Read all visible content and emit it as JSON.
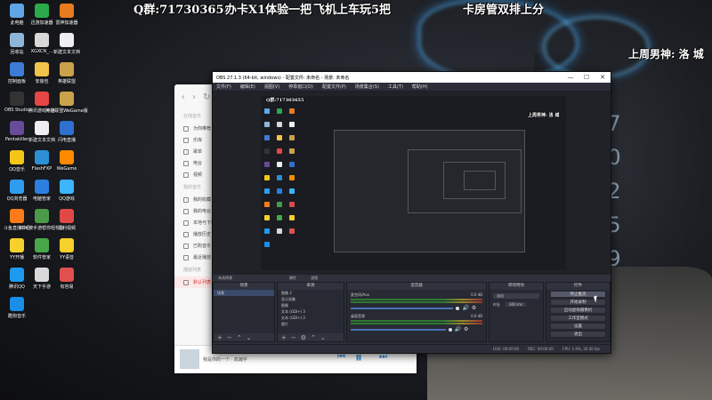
{
  "overlay": {
    "qq_group": "Q群:717303655",
    "card_promo": "办卡X1体验一把",
    "plane_promo": "飞机上车玩5把",
    "room_promo": "卡房管双排上分",
    "weekly_top": "上周男神: 洛 城"
  },
  "desktop_icons": [
    {
      "label": "此电脑",
      "color": "#5ea6e6"
    },
    {
      "label": "迅游加速器",
      "color": "#2aa84a"
    },
    {
      "label": "雷神加速器",
      "color": "#e87b1e"
    },
    {
      "label": "回收站",
      "color": "#8fb5d8"
    },
    {
      "label": "XGXCN_...",
      "color": "#d9d9d9"
    },
    {
      "label": "新建文本文档",
      "color": "#eeeeee"
    },
    {
      "label": "控制面板",
      "color": "#3d7bd6"
    },
    {
      "label": "安装包",
      "color": "#f0c34a"
    },
    {
      "label": "英雄联盟",
      "color": "#c9a24a"
    },
    {
      "label": "OBS Studio",
      "color": "#333333"
    },
    {
      "label": "腾讯游戏平台",
      "color": "#e64545"
    },
    {
      "label": "英雄联盟WeGame版",
      "color": "#c9a24a"
    },
    {
      "label": "Pentakiller",
      "color": "#6a4a9a"
    },
    {
      "label": "新建文本文档",
      "color": "#eeeeee"
    },
    {
      "label": "闪电直播",
      "color": "#2f6fd0"
    },
    {
      "label": "QQ音乐",
      "color": "#f5c518"
    },
    {
      "label": "FlashFXP",
      "color": "#2d8fd5"
    },
    {
      "label": "WeGame",
      "color": "#ff8a00"
    },
    {
      "label": "QQ浏览器",
      "color": "#2f9cf0"
    },
    {
      "label": "电脑管家",
      "color": "#2b7fe0"
    },
    {
      "label": "QQ游戏",
      "color": "#3cb4ff"
    },
    {
      "label": "斗鱼直播伴侣",
      "color": "#ff7a1a"
    },
    {
      "label": "KOK被手游帮你轻松玩",
      "color": "#4a9a4a"
    },
    {
      "label": "福利视频",
      "color": "#e04848"
    },
    {
      "label": "YY开播",
      "color": "#f6d02b"
    },
    {
      "label": "软件管家",
      "color": "#48a848"
    },
    {
      "label": "YY语音",
      "color": "#f6d02b"
    },
    {
      "label": "腾讯QQ",
      "color": "#1e9bf0"
    },
    {
      "label": "天下手游",
      "color": "#d9d9d9"
    },
    {
      "label": "有容易",
      "color": "#e05050"
    },
    {
      "label": "酷狗音乐",
      "color": "#1a8fe8"
    }
  ],
  "player": {
    "sections": [
      "在线音乐",
      "我的音乐",
      "播放列表"
    ],
    "online_items": [
      "为你推荐",
      "乐库",
      "歌单",
      "电台",
      "视频"
    ],
    "mine_items": [
      "我的收藏",
      "我的电台",
      "本地与下载",
      "播放历史",
      "已购音乐",
      "最近播放"
    ],
    "list_items": [
      "默认列表"
    ],
    "now_playing": "我是你的一个 · 高瀚宇"
  },
  "obs": {
    "title": "OBS 27.1.3 (64-bit, windows) - 配置文件: 未命名 - 场景: 未命名",
    "menu": [
      "文件(F)",
      "编辑(E)",
      "视图(V)",
      "停靠窗口(D)",
      "配置文件(P)",
      "场景集合(S)",
      "工具(T)",
      "帮助(H)"
    ],
    "no_source": "未选择源",
    "source_props": "属性",
    "source_filters": "滤镜",
    "docks": {
      "scenes": "场景",
      "sources": "来源",
      "mixer": "混音器",
      "transitions": "转场特效",
      "controls": "控件"
    },
    "scene_items": [
      "场景"
    ],
    "source_items": [
      "图像 2",
      "显示采集",
      "图像",
      "文本 (GDI+) 3",
      "文本 (GDI+) 2",
      "图片"
    ],
    "mixer_channels": [
      {
        "name": "麦克风/Aux",
        "db": "0.0 dB",
        "level_pct": 78
      },
      {
        "name": "桌面音频",
        "db": "0.0 dB",
        "level_pct": 72
      }
    ],
    "transition": {
      "type": "淡出",
      "duration_label": "时长",
      "duration": "300 ms"
    },
    "controls": [
      "停止推流",
      "开始录制",
      "启动虚拟摄像机",
      "工作室模式",
      "设置",
      "退出"
    ],
    "status": {
      "live": "LIVE: 00:00:00",
      "rec": "REC: 00:00:00",
      "cpu": "CPU: 1.9%, 30.00 fps"
    }
  }
}
